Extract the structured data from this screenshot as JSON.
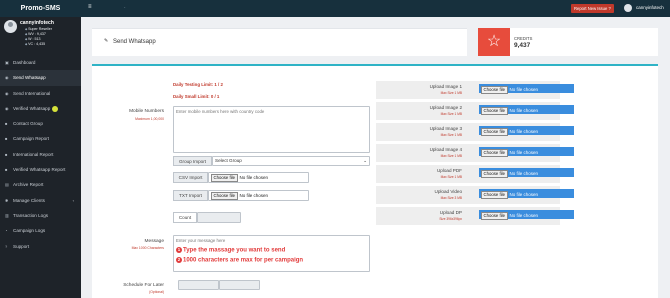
{
  "app": {
    "brand": "Promo-SMS",
    "report_label": "Report New Issue ?",
    "top_username": "cannyinfotech"
  },
  "profile": {
    "username": "cannyinfotech",
    "stats": [
      "Super Reseller",
      "WV : 9,437",
      "W : 513",
      "VC : 4,435"
    ]
  },
  "sidebar": {
    "items": [
      {
        "label": "Dashboard",
        "icon": "dashboard-icon"
      },
      {
        "label": "Send Whatsapp",
        "icon": "whatsapp-icon",
        "active": true
      },
      {
        "label": "Send International",
        "icon": "globe-icon"
      },
      {
        "label": "Verified Whatsapp",
        "icon": "verified-icon"
      },
      {
        "label": "Contact Group",
        "icon": "users-icon"
      },
      {
        "label": "Campaign Report",
        "icon": "report-icon"
      },
      {
        "label": "International Report",
        "icon": "report-icon"
      },
      {
        "label": "Verified Whatsapp Report",
        "icon": "report-icon"
      },
      {
        "label": "Archive Report",
        "icon": "archive-icon"
      },
      {
        "label": "Manage Clients",
        "icon": "settings-icon",
        "chevron": "‹"
      },
      {
        "label": "Transaction Logs",
        "icon": "chart-icon"
      },
      {
        "label": "Campaign Logs",
        "icon": "clock-icon"
      },
      {
        "label": "Support",
        "icon": "help-icon"
      }
    ]
  },
  "header": {
    "title": "Send Whatsapp"
  },
  "credits": {
    "label": "CREDITS",
    "value": "9,437"
  },
  "form": {
    "testing_limit": "Daily Testing Limit: 1 / 2",
    "small_limit": "Daily Small Limit: 0 / 1",
    "mobile_label": "Mobile Numbers",
    "mobile_sub": "Maximum 1,00,000",
    "mobile_placeholder": "Enter mobile numbers here with country code",
    "group_import_label": "Group Import",
    "group_select_value": "Select Group",
    "csv_label": "CSV Import",
    "txt_label": "TXT Import",
    "choose_label": "Choose file",
    "no_file": "No file chosen",
    "count_label": "Count",
    "message_label": "Message",
    "message_sub": "Max 1000 Characters",
    "message_placeholder": "Enter your message here",
    "hint1": "Type the massage you want to send",
    "hint2": "1000 characters are max for per campaign",
    "hint1_num": "1",
    "hint2_num": "2",
    "schedule_label": "Schedule For Later",
    "schedule_sub": "(Optional)"
  },
  "uploads": [
    {
      "label": "Upload Image 1",
      "sub": "Max Size 1 MB"
    },
    {
      "label": "Upload Image 2",
      "sub": "Max Size 1 MB"
    },
    {
      "label": "Upload Image 3",
      "sub": "Max Size 1 MB"
    },
    {
      "label": "Upload Image 4",
      "sub": "Max Size 1 MB"
    },
    {
      "label": "Upload PDF",
      "sub": "Max Size 1 MB"
    },
    {
      "label": "Upload Video",
      "sub": "Max Size 3 MB"
    },
    {
      "label": "Upload DP",
      "sub": "Size 396x396px"
    }
  ],
  "colors": {
    "accent": "#2fb3c6",
    "danger": "#e74c3c",
    "sidebar": "#1e2329",
    "topbar": "#17303d",
    "upload": "#3a8dde"
  }
}
